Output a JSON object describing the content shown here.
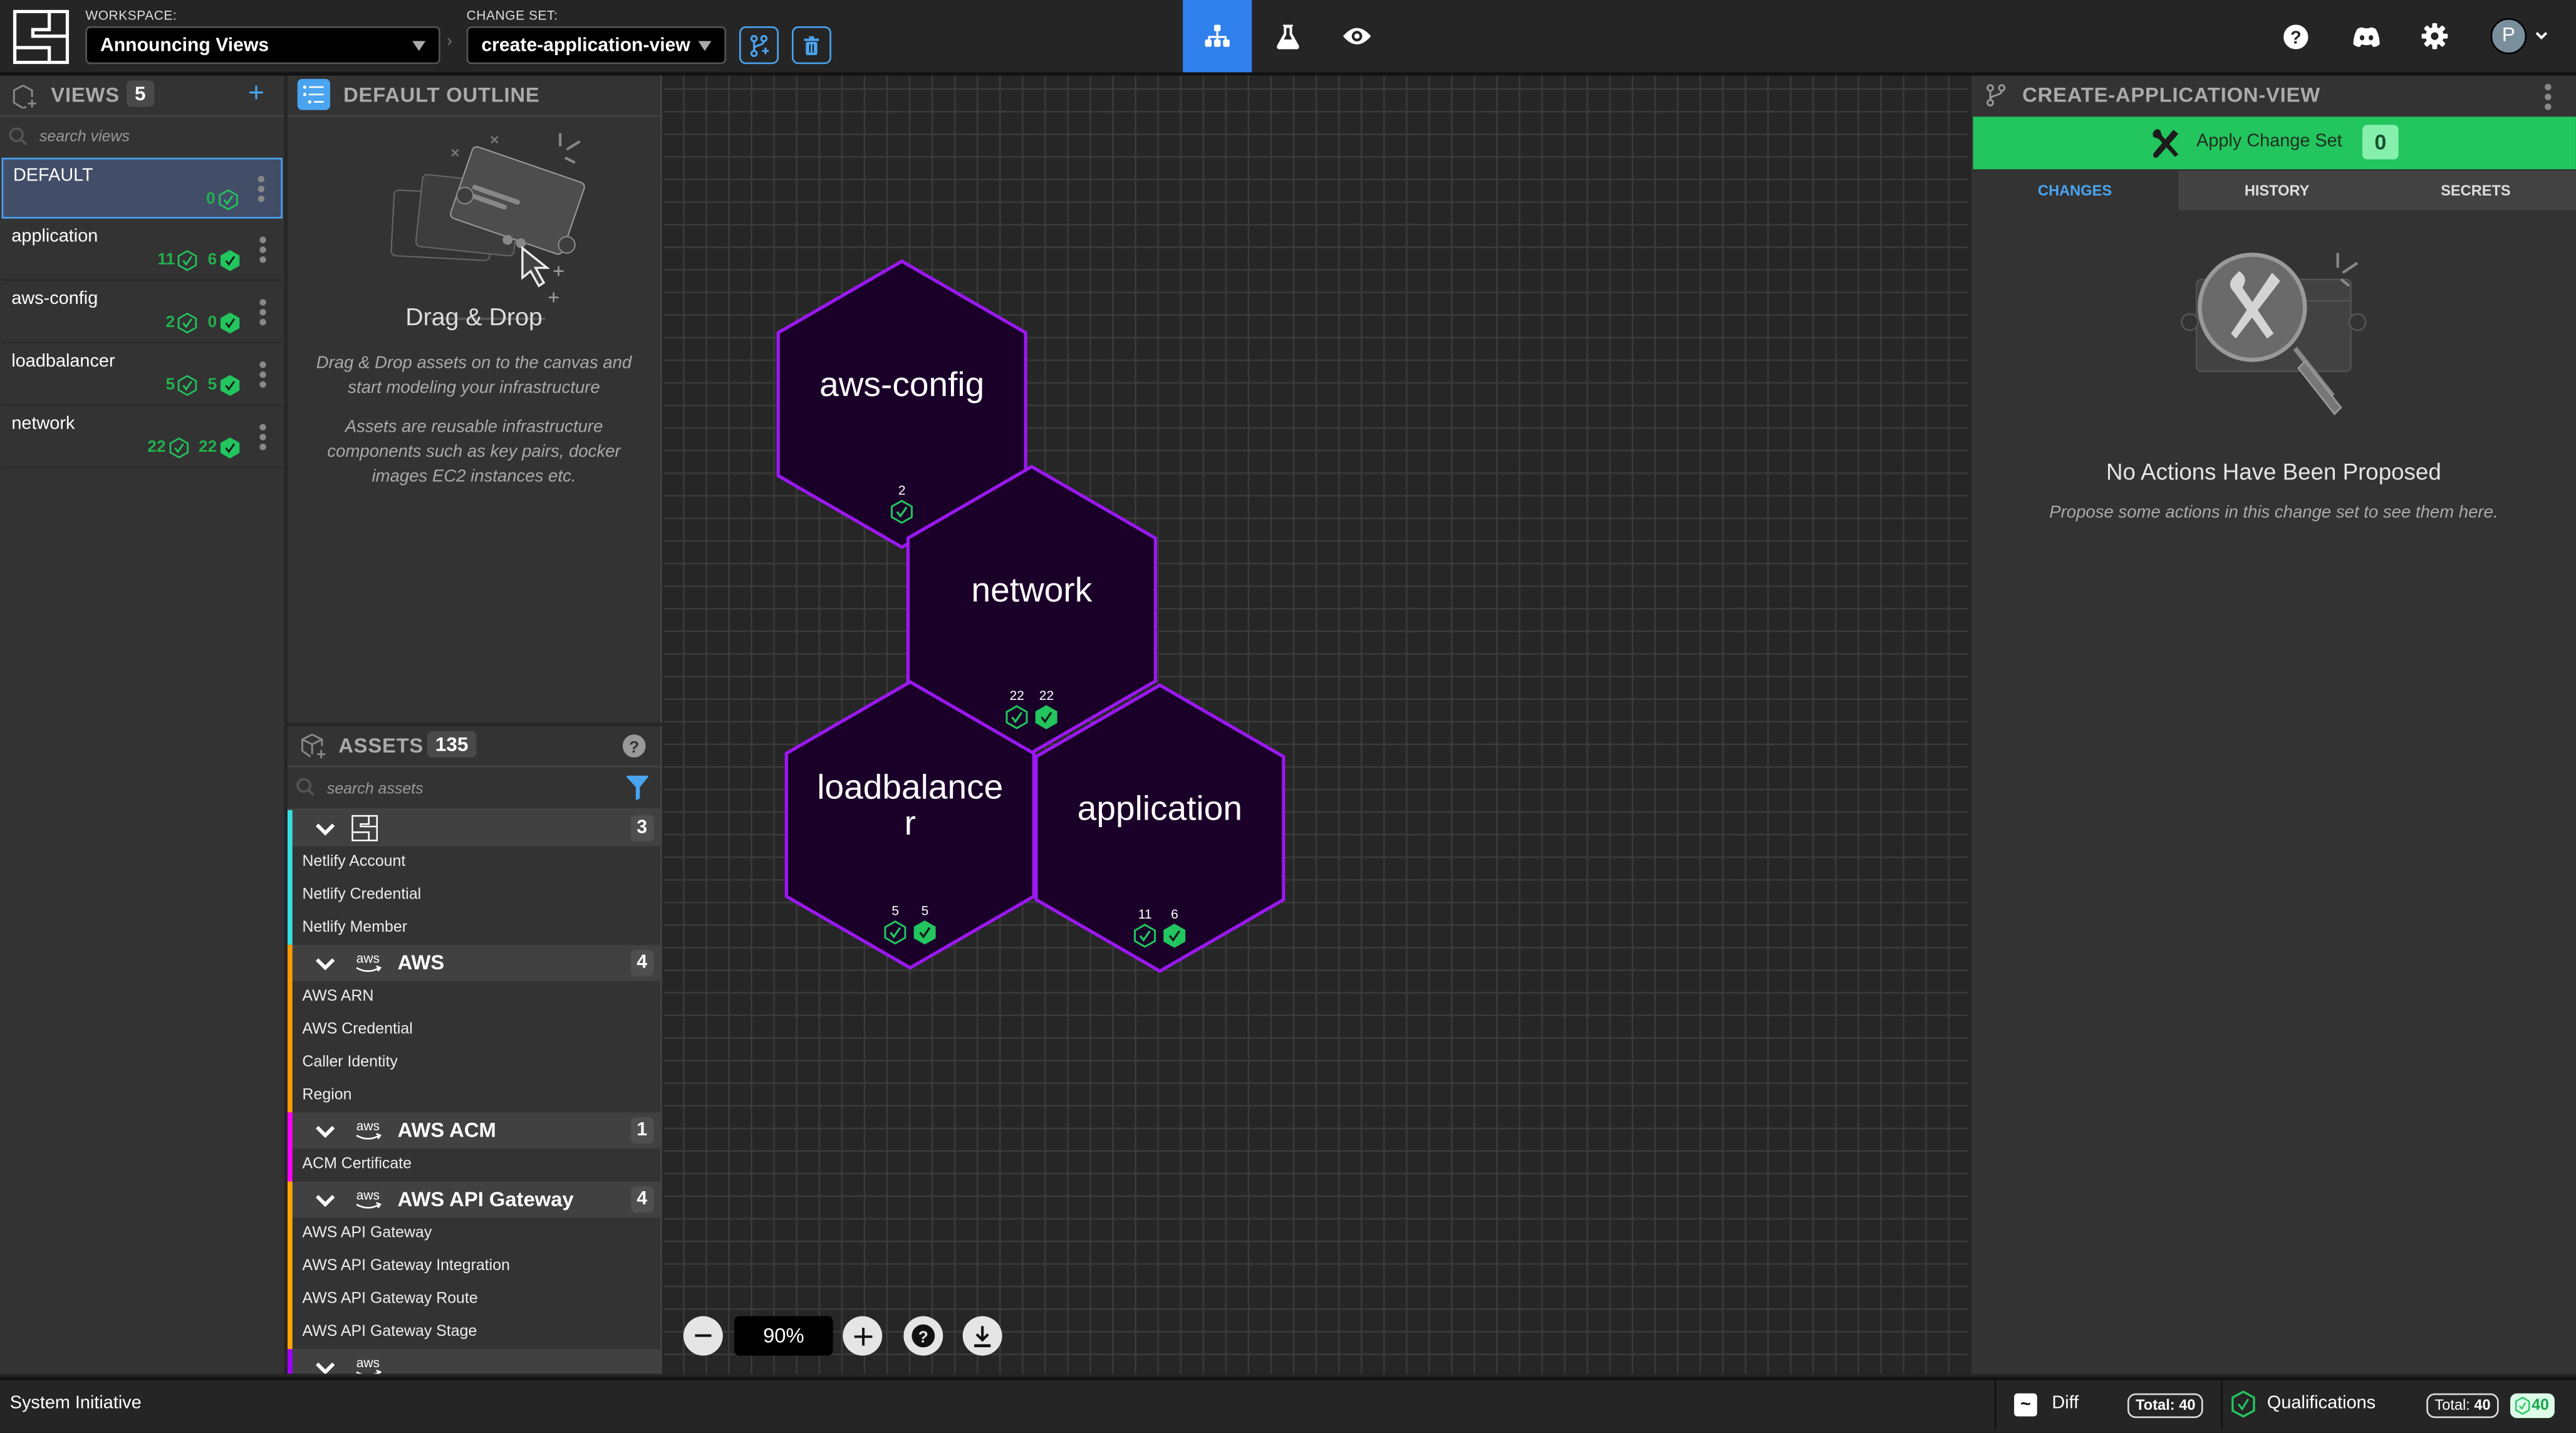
{
  "header": {
    "workspace_label": "WORKSPACE:",
    "workspace_value": "Announcing Views",
    "changeset_label": "CHANGE SET:",
    "changeset_value": "create-application-view",
    "user_initial": "P",
    "nav_tabs": [
      {
        "name": "model",
        "icon": "diagram-icon",
        "active": true
      },
      {
        "name": "customize",
        "icon": "beaker-icon",
        "active": false
      },
      {
        "name": "audit",
        "icon": "eye-icon",
        "active": false
      }
    ],
    "accent_color": "#2f80ed"
  },
  "views": {
    "title": "VIEWS",
    "count": "5",
    "search_placeholder": "search views",
    "items": [
      {
        "name": "DEFAULT",
        "selected": true,
        "stats": [
          {
            "value": "0",
            "kind": "outline"
          }
        ]
      },
      {
        "name": "application",
        "selected": false,
        "stats": [
          {
            "value": "11",
            "kind": "outline"
          },
          {
            "value": "6",
            "kind": "filled"
          }
        ]
      },
      {
        "name": "aws-config",
        "selected": false,
        "stats": [
          {
            "value": "2",
            "kind": "outline"
          },
          {
            "value": "0",
            "kind": "filled"
          }
        ]
      },
      {
        "name": "loadbalancer",
        "selected": false,
        "stats": [
          {
            "value": "5",
            "kind": "outline"
          },
          {
            "value": "5",
            "kind": "filled"
          }
        ]
      },
      {
        "name": "network",
        "selected": false,
        "stats": [
          {
            "value": "22",
            "kind": "outline"
          },
          {
            "value": "22",
            "kind": "filled"
          }
        ]
      }
    ]
  },
  "outline": {
    "title": "DEFAULT OUTLINE",
    "empty_title": "Drag & Drop",
    "empty_text_1": "Drag & Drop assets on to the canvas and start modeling your infrastructure",
    "empty_text_2": "Assets are reusable infrastructure components such as key pairs, docker images EC2 instances etc."
  },
  "assets": {
    "title": "ASSETS",
    "count": "135",
    "search_placeholder": "search assets",
    "groups": [
      {
        "title": "",
        "icon": "si-logo-icon",
        "count": "3",
        "color": "#33e0e0",
        "items": [
          "Netlify Account",
          "Netlify Credential",
          "Netlify Member"
        ]
      },
      {
        "title": "AWS",
        "icon": "aws-icon",
        "count": "4",
        "color": "#ff9900",
        "items": [
          "AWS ARN",
          "AWS Credential",
          "Caller Identity",
          "Region"
        ]
      },
      {
        "title": "AWS ACM",
        "icon": "aws-icon",
        "count": "1",
        "color": "#ff00ff",
        "items": [
          "ACM Certificate"
        ]
      },
      {
        "title": "AWS API Gateway",
        "icon": "aws-icon",
        "count": "4",
        "color": "#ffa500",
        "items": [
          "AWS API Gateway",
          "AWS API Gateway Integration",
          "AWS API Gateway Route",
          "AWS API Gateway Stage"
        ]
      },
      {
        "title": "",
        "icon": "aws-icon",
        "count": "",
        "color": "#a000ff",
        "items": []
      }
    ]
  },
  "canvas": {
    "zoom_level": "90%",
    "views": [
      {
        "name": "aws-config",
        "stats": [
          {
            "value": "2",
            "kind": "outline"
          }
        ]
      },
      {
        "name": "network",
        "stats": [
          {
            "value": "22",
            "kind": "outline"
          },
          {
            "value": "22",
            "kind": "filled"
          }
        ]
      },
      {
        "name": "loadbalancer",
        "stats": [
          {
            "value": "5",
            "kind": "outline"
          },
          {
            "value": "5",
            "kind": "filled"
          }
        ]
      },
      {
        "name": "application",
        "stats": [
          {
            "value": "11",
            "kind": "outline"
          },
          {
            "value": "6",
            "kind": "filled"
          }
        ]
      }
    ],
    "hex_fill": "#1a0028",
    "hex_stroke": "#9b18f0"
  },
  "changeset_panel": {
    "title": "CREATE-APPLICATION-VIEW",
    "apply_label": "Apply Change Set",
    "apply_count": "0",
    "apply_color": "#22c55e",
    "tabs": [
      {
        "label": "CHANGES",
        "active": true
      },
      {
        "label": "HISTORY",
        "active": false
      },
      {
        "label": "SECRETS",
        "active": false
      }
    ],
    "empty_title": "No Actions Have Been Proposed",
    "empty_text": "Propose some actions in this change set to see them here."
  },
  "status_bar": {
    "brand": "System Initiative",
    "diff_label": "Diff",
    "diff_total_label": "Total:",
    "diff_total": "40",
    "qual_label": "Qualifications",
    "qual_total_label": "Total:",
    "qual_total": "40",
    "qual_passed": "40"
  }
}
